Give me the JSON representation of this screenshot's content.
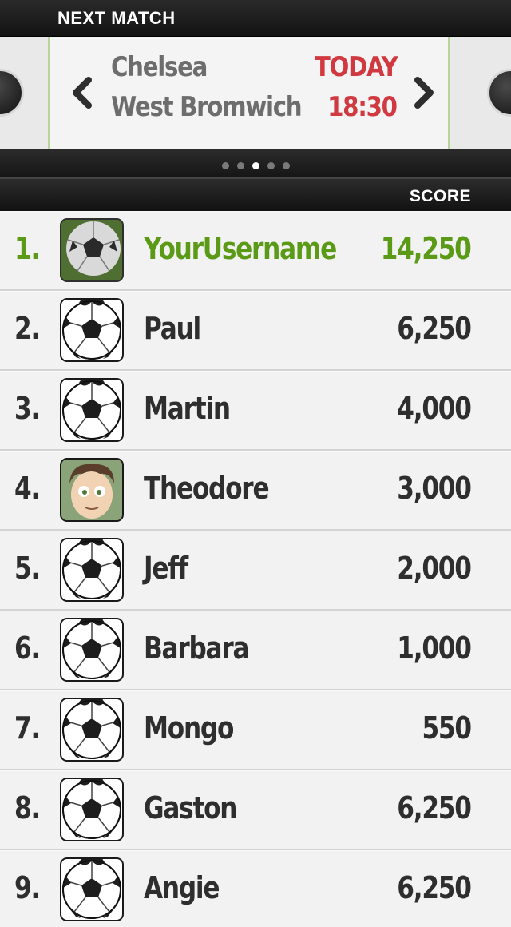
{
  "header": {
    "title": "NEXT MATCH"
  },
  "match": {
    "home_team": "Chelsea",
    "away_team": "West Bromwich",
    "day": "TODAY",
    "time": "18:30",
    "pager": {
      "total": 5,
      "active_index": 2
    }
  },
  "leaderboard": {
    "column_label": "SCORE",
    "rows": [
      {
        "rank": "1.",
        "name": "YourUsername",
        "score": "14,250",
        "avatar": "grass-ball",
        "is_user": true
      },
      {
        "rank": "2.",
        "name": "Paul",
        "score": "6,250",
        "avatar": "ball"
      },
      {
        "rank": "3.",
        "name": "Martin",
        "score": "4,000",
        "avatar": "ball"
      },
      {
        "rank": "4.",
        "name": "Theodore",
        "score": "3,000",
        "avatar": "face"
      },
      {
        "rank": "5.",
        "name": "Jeff",
        "score": "2,000",
        "avatar": "ball"
      },
      {
        "rank": "6.",
        "name": "Barbara",
        "score": "1,000",
        "avatar": "ball"
      },
      {
        "rank": "7.",
        "name": "Mongo",
        "score": "550",
        "avatar": "ball"
      },
      {
        "rank": "8.",
        "name": "Gaston",
        "score": "6,250",
        "avatar": "ball"
      },
      {
        "rank": "9.",
        "name": "Angie",
        "score": "6,250",
        "avatar": "ball"
      }
    ]
  },
  "colors": {
    "accent_green": "#5b9a16",
    "accent_red": "#d0393f"
  }
}
